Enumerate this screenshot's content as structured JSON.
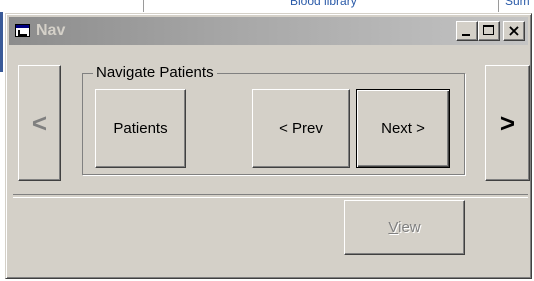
{
  "background_window": {
    "text_1": "Blood library",
    "text_2": "Sum"
  },
  "window": {
    "title": "Nav",
    "controls": {
      "minimize": "_",
      "maximize": "□",
      "close": "×"
    }
  },
  "nav": {
    "left_arrow": "<",
    "right_arrow": ">"
  },
  "group": {
    "label": "Navigate  Patients",
    "buttons": {
      "patients": "Patients",
      "prev": "< Prev",
      "next": "Next >"
    }
  },
  "footer": {
    "view_mnemonic": "V",
    "view_rest": "iew"
  }
}
